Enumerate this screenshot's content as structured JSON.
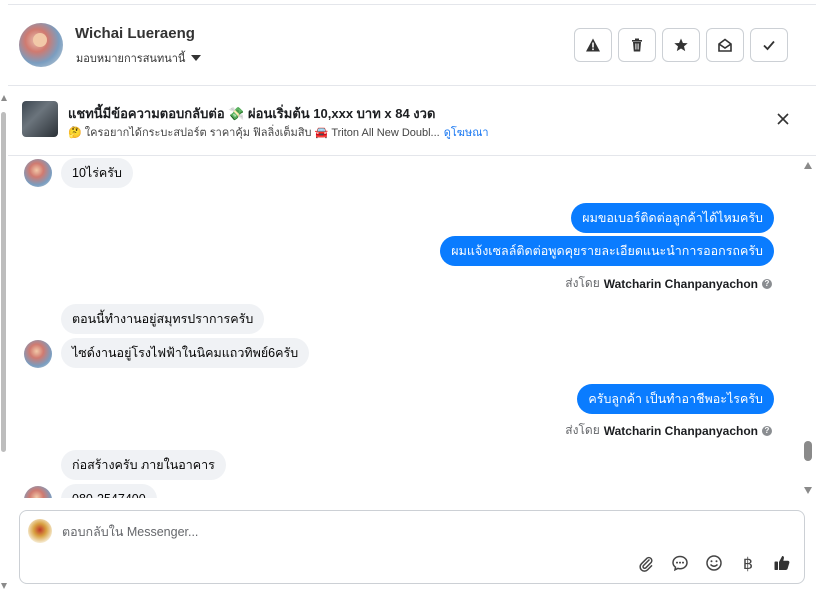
{
  "header": {
    "contact_name": "Wichai Lueraeng",
    "assign_label": "มอบหมายการสนทนานี้",
    "actions": [
      {
        "icon": "warning-icon",
        "name": "spam-button"
      },
      {
        "icon": "trash-icon",
        "name": "delete-button"
      },
      {
        "icon": "star-icon",
        "name": "star-button"
      },
      {
        "icon": "mark-unread-icon",
        "name": "mark-unread-button"
      },
      {
        "icon": "check-icon",
        "name": "mark-done-button"
      }
    ]
  },
  "ad": {
    "title": "แชทนี้มีข้อความตอบกลับต่อ 💸 ผ่อนเริ่มต้น 10,xxx บาท x 84 งวด",
    "subtitle": "🤔 ใครอยากได้กระบะสปอร์ต ราคาคุ้ม ฟิลลิ่งเต็มสิบ 🚘 Triton All New Doubl...",
    "link": "ดูโฆษณา"
  },
  "messages": [
    {
      "dir": "in",
      "text": "10ไร่ครับ"
    },
    {
      "dir": "out",
      "text": "ผมขอเบอร์ติดต่อลูกค้าได้ไหมครับ"
    },
    {
      "dir": "out",
      "text": "ผมแจ้งเซลล์ติดต่อพูดคุยรายละเอียดแนะนำการออกรถครับ"
    },
    {
      "dir": "sentby",
      "prefix": "ส่งโดย",
      "name": "Watcharin Chanpanyachon"
    },
    {
      "dir": "in",
      "text": "ตอนนี้ทำงานอยู่สมุทรปราการครับ"
    },
    {
      "dir": "in",
      "text": "ไซด์งานอยู่โรงไฟฟ้าในนิคมแถวทิพย์6ครับ"
    },
    {
      "dir": "out",
      "text": "ครับลูกค้า เป็นทำอาชีพอะไรครับ"
    },
    {
      "dir": "sentby",
      "prefix": "ส่งโดย",
      "name": "Watcharin Chanpanyachon"
    },
    {
      "dir": "in",
      "text": "ก่อสร้างครับ ภายในอาคาร"
    },
    {
      "dir": "in",
      "text": "080-2547400"
    }
  ],
  "composer": {
    "placeholder": "ตอบกลับใน Messenger..."
  },
  "colors": {
    "outgoing_bubble": "#0a7cff",
    "incoming_bubble": "#f0f2f5"
  }
}
